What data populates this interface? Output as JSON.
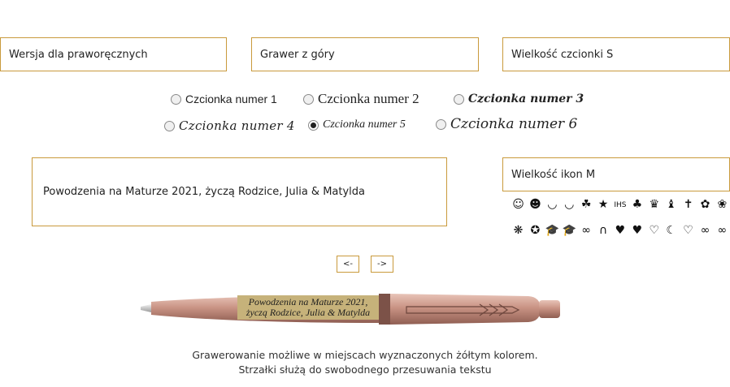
{
  "selects": {
    "hand": "Wersja dla praworęcznych",
    "position": "Grawer z góry",
    "font_size": "Wielkość czcionki S",
    "icon_size": "Wielkość ikon M"
  },
  "fonts": [
    {
      "label": "Czcionka numer 1",
      "selected": false
    },
    {
      "label": "Czcionka numer 2",
      "selected": false
    },
    {
      "label": "Czcionka numer 3",
      "selected": false
    },
    {
      "label": "Czcionka numer 4",
      "selected": false
    },
    {
      "label": "Czcionka numer 5",
      "selected": true
    },
    {
      "label": "Czcionka numer 6",
      "selected": false
    }
  ],
  "engraving_text": "Powodzenia na Maturze 2021, życzą Rodzice, Julia & Matylda",
  "engraving_preview": {
    "line1": "Powodzenia na Maturze 2021,",
    "line2": "życzą Rodzice, Julia & Matylda"
  },
  "icons_row1": [
    "☺",
    "☻",
    "◡",
    "◡",
    "☘",
    "★",
    "IHS",
    "♣",
    "♛",
    "♝",
    "✝",
    "✿",
    "❀"
  ],
  "icons_row2": [
    "❋",
    "✪",
    "🎓",
    "🎓",
    "∞",
    "∩",
    "♥",
    "♥",
    "♡",
    "☾",
    "♡",
    "∞",
    "∞"
  ],
  "arrows": {
    "left": "<-",
    "right": "->"
  },
  "notes": {
    "line1": "Grawerowanie możliwe w miejscach wyznaczonych żółtym kolorem.",
    "line2": "Strzałki służą do swobodnego przesuwania tekstu"
  },
  "colors": {
    "accent": "#c99a3c",
    "pen": "#c99384",
    "engrave_area": "#c6b27a"
  }
}
